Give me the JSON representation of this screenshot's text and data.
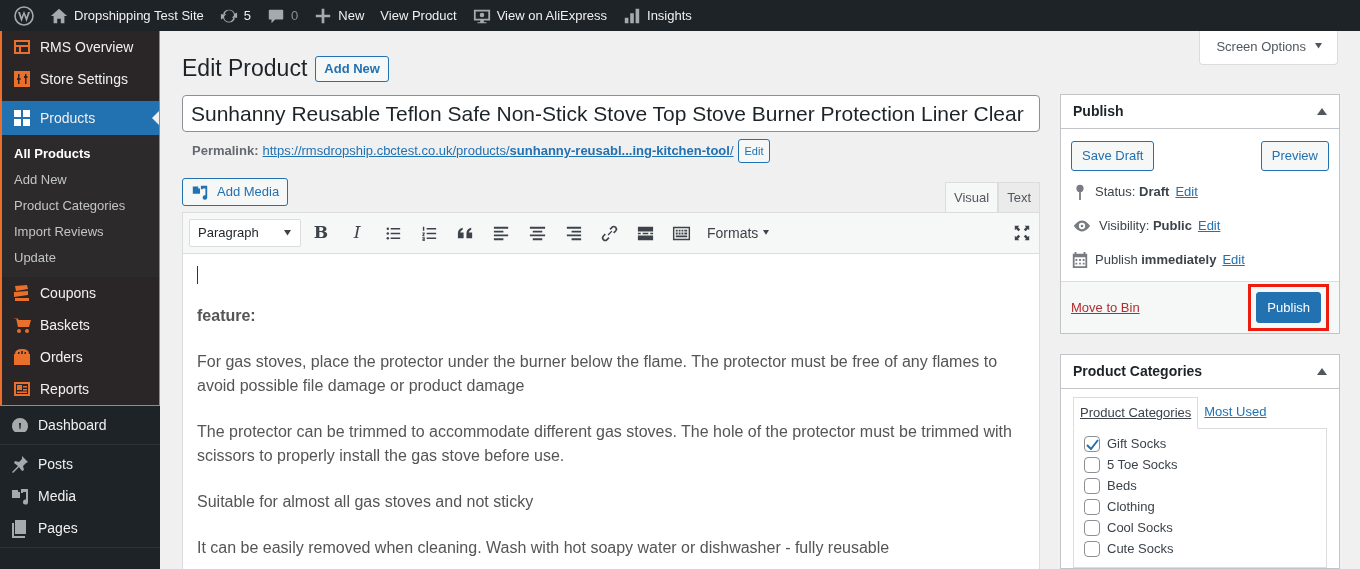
{
  "admin_bar": {
    "items": [
      {
        "kind": "logo"
      },
      {
        "kind": "home",
        "label": "Dropshipping Test Site"
      },
      {
        "kind": "updates",
        "label": "5"
      },
      {
        "kind": "comments",
        "label": "0",
        "disabled": true
      },
      {
        "kind": "new",
        "label": "New"
      },
      {
        "kind": "plain",
        "label": "View Product"
      },
      {
        "kind": "monitor",
        "label": "View on AliExpress"
      },
      {
        "kind": "insights",
        "label": "Insights"
      }
    ]
  },
  "screen_options": {
    "label": "Screen Options"
  },
  "sidebar": {
    "sections": [
      {
        "kind": "plugin",
        "items": [
          {
            "label": "RMS Overview",
            "selected": false
          },
          {
            "label": "Store Settings",
            "selected": false
          },
          {
            "label": "Products",
            "selected": true,
            "children": [
              {
                "label": "All Products",
                "selected": true
              },
              {
                "label": "Add New",
                "selected": false
              },
              {
                "label": "Product Categories",
                "selected": false
              },
              {
                "label": "Import Reviews",
                "selected": false
              },
              {
                "label": "Update",
                "selected": false
              }
            ]
          },
          {
            "label": "Coupons",
            "selected": false
          },
          {
            "label": "Baskets",
            "selected": false
          },
          {
            "label": "Orders",
            "selected": false
          },
          {
            "label": "Reports",
            "selected": false
          }
        ]
      },
      {
        "kind": "core",
        "items": [
          {
            "label": "Dashboard",
            "selected": false
          }
        ]
      },
      {
        "kind": "core",
        "items": [
          {
            "label": "Posts",
            "selected": false
          },
          {
            "label": "Media",
            "selected": false
          },
          {
            "label": "Pages",
            "selected": false
          }
        ]
      }
    ]
  },
  "page": {
    "title": "Edit Product",
    "add_new": "Add New"
  },
  "title_field": {
    "value": "Sunhanny Reusable Teflon Safe Non-Stick Stove Top Stove Burner Protection Liner Clear"
  },
  "permalink": {
    "label": "Permalink:",
    "url": "https://rmsdropship.cbctest.co.uk/products/**sunhanny-reusabl...ing-kitchen-tool**/",
    "edit": "Edit"
  },
  "editor": {
    "add_media": "Add Media",
    "tabs": [
      {
        "label": "Visual",
        "selected": true
      },
      {
        "label": "Text",
        "selected": false
      }
    ],
    "format_select": "Paragraph",
    "toolbar": [
      {
        "kind": "bold",
        "label": "B"
      },
      {
        "kind": "italic",
        "label": "I"
      },
      {
        "kind": "bullets"
      },
      {
        "kind": "numbers"
      },
      {
        "kind": "quote"
      },
      {
        "kind": "align-left"
      },
      {
        "kind": "align-center"
      },
      {
        "kind": "align-right"
      },
      {
        "kind": "link"
      },
      {
        "kind": "more"
      },
      {
        "kind": "toolbar-toggle"
      },
      {
        "kind": "formats",
        "label": "Formats"
      }
    ],
    "paragraphs": [
      {
        "text": "feature:",
        "bold": true
      },
      {
        "text": "For gas stoves, place the protector under the burner below the flame. The protector must be free of any flames to avoid possible file damage or product damage",
        "bold": false
      },
      {
        "text": "The protector can be trimmed to accommodate different gas stoves. The hole of the protector must be trimmed with scissors to properly install the gas stove before use.",
        "bold": false
      },
      {
        "text": "Suitable for almost all gas stoves and not sticky",
        "bold": false
      },
      {
        "text": "It can be easily removed when cleaning. Wash with hot soapy water or dishwasher - fully reusable",
        "bold": false
      }
    ]
  },
  "publish": {
    "title": "Publish",
    "save_draft": "Save Draft",
    "preview": "Preview",
    "rows": [
      {
        "kind": "status",
        "label": "Status:",
        "value": "Draft",
        "link": "Edit"
      },
      {
        "kind": "visibility",
        "label": "Visibility:",
        "value": "Public",
        "link": "Edit"
      },
      {
        "kind": "schedule",
        "label": "Publish",
        "value": "immediately",
        "link": "Edit"
      }
    ],
    "move_to_bin": "Move to Bin",
    "publish_button": "Publish",
    "highlighted": true
  },
  "categories": {
    "title": "Product Categories",
    "tabs": [
      {
        "label": "Product Categories",
        "selected": true
      },
      {
        "label": "Most Used",
        "selected": false
      }
    ],
    "items": [
      {
        "label": "Gift Socks",
        "checked": true
      },
      {
        "label": "5 Toe Socks",
        "checked": false
      },
      {
        "label": "Beds",
        "checked": false
      },
      {
        "label": "Clothing",
        "checked": false
      },
      {
        "label": "Cool Socks",
        "checked": false
      },
      {
        "label": "Cute Socks",
        "checked": false
      }
    ]
  }
}
